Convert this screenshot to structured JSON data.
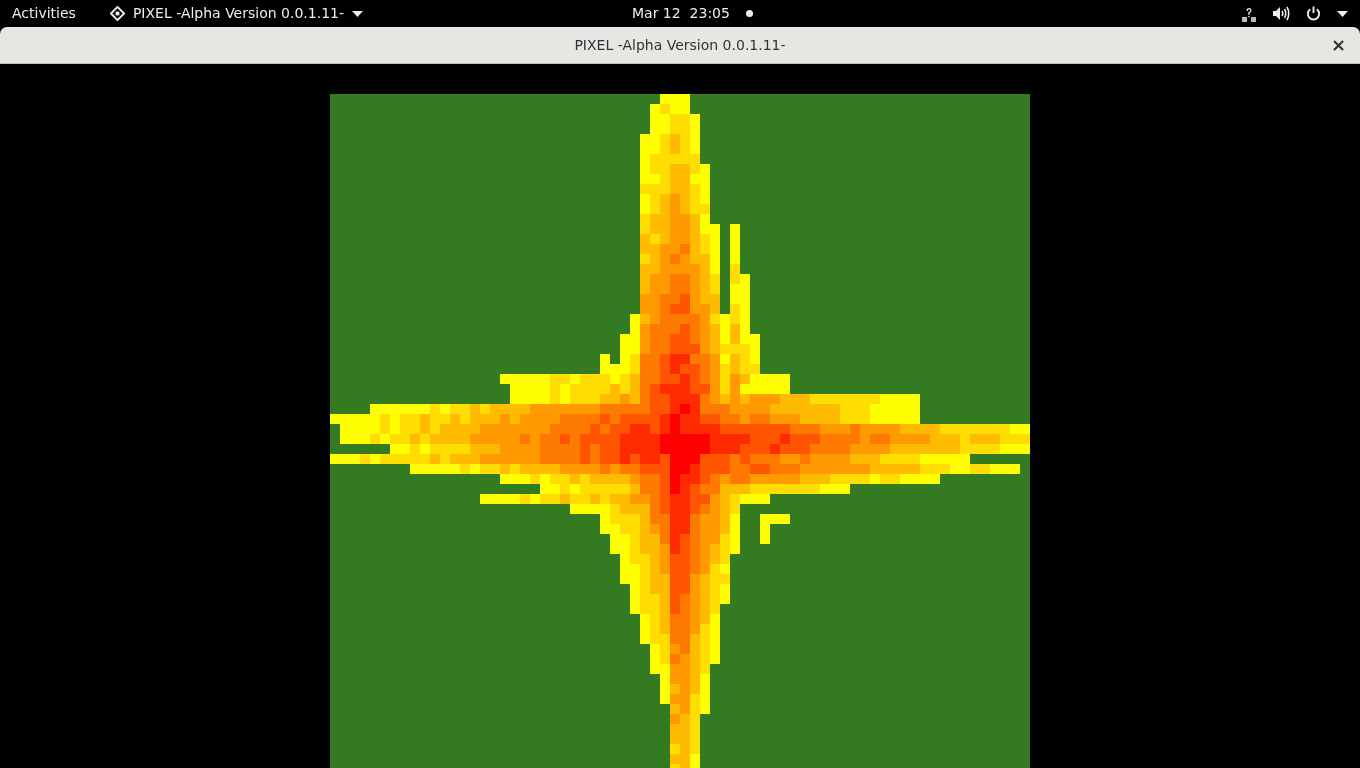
{
  "top_bar": {
    "activities": "Activities",
    "app_menu": "PIXEL -Alpha Version 0.0.1.11-",
    "clock": "Mar 12  23:05",
    "notification_dot": true
  },
  "window": {
    "title": "PIXEL -Alpha Version 0.0.1.11-",
    "close": "×"
  }
}
